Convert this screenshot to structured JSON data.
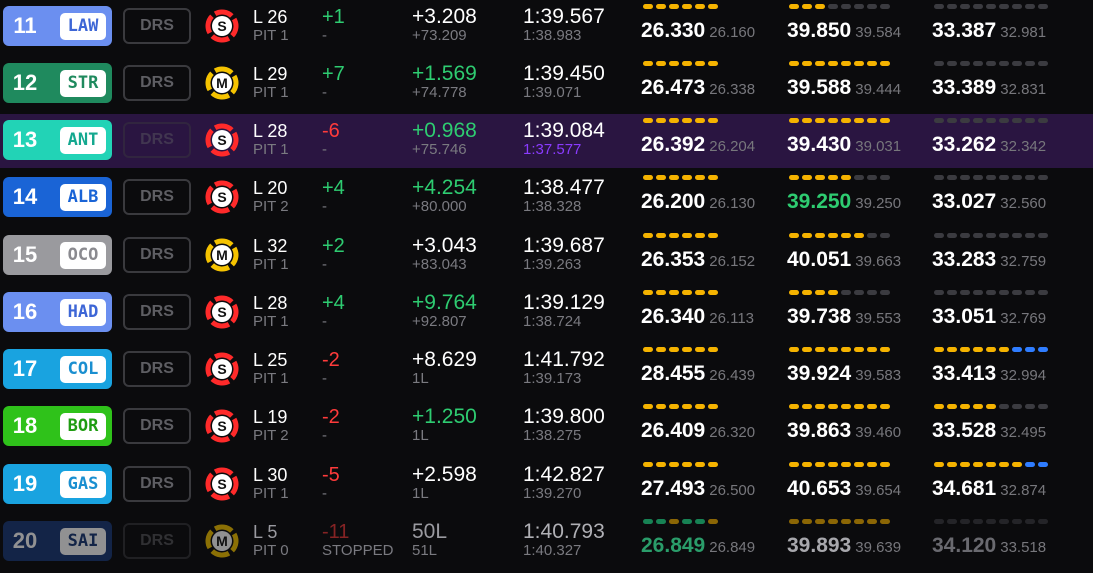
{
  "colors": {
    "yellow": "#f5b300",
    "grey": "#3b3b40",
    "blue": "#2f7dff",
    "green": "#1aa066",
    "soft": "#ff2a2a",
    "medium": "#f5c300",
    "purple": "#8a3bff"
  },
  "drs_label": "DRS",
  "rows": [
    {
      "pos": "11",
      "code": "LAW",
      "team_color": "#6b8ff0",
      "code_color": "#3d66d6",
      "tyre": "S",
      "lap": "L 26",
      "pit": "PIT 1",
      "chg": "+1",
      "chg_sub": "-",
      "gap": "+3.208",
      "gap_sub": "+73.209",
      "last": "1:39.567",
      "best": "1:38.983",
      "s1": "26.330",
      "s1b": "26.160",
      "s2": "39.850",
      "s2b": "39.584",
      "s3": "33.387",
      "s3b": "32.981",
      "m1": [
        "y",
        "y",
        "y",
        "y",
        "y",
        "y"
      ],
      "m2": [
        "y",
        "y",
        "y",
        "g",
        "g",
        "g",
        "g",
        "g"
      ],
      "m3": [
        "g",
        "g",
        "g",
        "g",
        "g",
        "g",
        "g",
        "g",
        "g"
      ]
    },
    {
      "pos": "12",
      "code": "STR",
      "team_color": "#1f8a5e",
      "code_color": "#1f8a5e",
      "tyre": "M",
      "lap": "L 29",
      "pit": "PIT 1",
      "chg": "+7",
      "chg_sub": "-",
      "gap": "+1.569",
      "gap_sub": "+74.778",
      "last": "1:39.450",
      "best": "1:39.071",
      "s1": "26.473",
      "s1b": "26.338",
      "s2": "39.588",
      "s2b": "39.444",
      "s3": "33.389",
      "s3b": "32.831",
      "m1": [
        "y",
        "y",
        "y",
        "y",
        "y",
        "y"
      ],
      "m2": [
        "y",
        "y",
        "y",
        "y",
        "y",
        "y",
        "y",
        "y"
      ],
      "m3": [
        "g",
        "g",
        "g",
        "g",
        "g",
        "g",
        "g",
        "g",
        "g"
      ]
    },
    {
      "pos": "13",
      "code": "ANT",
      "team_color": "#22d3b6",
      "code_color": "#14a88f",
      "tyre": "S",
      "lap": "L 28",
      "pit": "PIT 1",
      "chg": "-6",
      "chg_sub": "-",
      "gap": "+0.968",
      "gap_sub": "+75.746",
      "last": "1:39.084",
      "best": "1:37.577",
      "s1": "26.392",
      "s1b": "26.204",
      "s2": "39.430",
      "s2b": "39.031",
      "s3": "33.262",
      "s3b": "32.342",
      "m1": [
        "y",
        "y",
        "y",
        "y",
        "y",
        "y"
      ],
      "m2": [
        "y",
        "y",
        "y",
        "y",
        "y",
        "y",
        "y",
        "y"
      ],
      "m3": [
        "g",
        "g",
        "g",
        "g",
        "g",
        "g",
        "g",
        "g",
        "g"
      ]
    },
    {
      "pos": "14",
      "code": "ALB",
      "team_color": "#1a64d6",
      "code_color": "#1a64d6",
      "tyre": "S",
      "lap": "L 20",
      "pit": "PIT 2",
      "chg": "+4",
      "chg_sub": "-",
      "gap": "+4.254",
      "gap_sub": "+80.000",
      "last": "1:38.477",
      "best": "1:38.328",
      "s1": "26.200",
      "s1b": "26.130",
      "s2": "39.250",
      "s2b": "39.250",
      "s3": "33.027",
      "s3b": "32.560",
      "m1": [
        "y",
        "y",
        "y",
        "y",
        "y",
        "y"
      ],
      "m2": [
        "y",
        "y",
        "y",
        "y",
        "y",
        "g",
        "g",
        "g"
      ],
      "m3": [
        "g",
        "g",
        "g",
        "g",
        "g",
        "g",
        "g",
        "g",
        "g"
      ]
    },
    {
      "pos": "15",
      "code": "OCO",
      "team_color": "#9a9a9e",
      "code_color": "#8a8a8f",
      "tyre": "M",
      "lap": "L 32",
      "pit": "PIT 1",
      "chg": "+2",
      "chg_sub": "-",
      "gap": "+3.043",
      "gap_sub": "+83.043",
      "last": "1:39.687",
      "best": "1:39.263",
      "s1": "26.353",
      "s1b": "26.152",
      "s2": "40.051",
      "s2b": "39.663",
      "s3": "33.283",
      "s3b": "32.759",
      "m1": [
        "y",
        "y",
        "y",
        "y",
        "y",
        "y"
      ],
      "m2": [
        "y",
        "y",
        "y",
        "y",
        "y",
        "y",
        "g",
        "g"
      ],
      "m3": [
        "g",
        "g",
        "g",
        "g",
        "g",
        "g",
        "g",
        "g",
        "g"
      ]
    },
    {
      "pos": "16",
      "code": "HAD",
      "team_color": "#6b8ff0",
      "code_color": "#3d66d6",
      "tyre": "S",
      "lap": "L 28",
      "pit": "PIT 1",
      "chg": "+4",
      "chg_sub": "-",
      "gap": "+9.764",
      "gap_sub": "+92.807",
      "last": "1:39.129",
      "best": "1:38.724",
      "s1": "26.340",
      "s1b": "26.113",
      "s2": "39.738",
      "s2b": "39.553",
      "s3": "33.051",
      "s3b": "32.769",
      "m1": [
        "y",
        "y",
        "y",
        "y",
        "y",
        "y"
      ],
      "m2": [
        "y",
        "y",
        "y",
        "y",
        "g",
        "g",
        "g",
        "g"
      ],
      "m3": [
        "g",
        "g",
        "g",
        "g",
        "g",
        "g",
        "g",
        "g",
        "g"
      ]
    },
    {
      "pos": "17",
      "code": "COL",
      "team_color": "#19a3e0",
      "code_color": "#1a8fd0",
      "tyre": "S",
      "lap": "L 25",
      "pit": "PIT 1",
      "chg": "-2",
      "chg_sub": "-",
      "gap": "+8.629",
      "gap_sub": "1L",
      "last": "1:41.792",
      "best": "1:39.173",
      "s1": "28.455",
      "s1b": "26.439",
      "s2": "39.924",
      "s2b": "39.583",
      "s3": "33.413",
      "s3b": "32.994",
      "m1": [
        "y",
        "y",
        "y",
        "y",
        "y",
        "y"
      ],
      "m2": [
        "y",
        "y",
        "y",
        "y",
        "y",
        "y",
        "y",
        "y"
      ],
      "m3": [
        "y",
        "y",
        "y",
        "y",
        "y",
        "y",
        "b",
        "b",
        "b"
      ]
    },
    {
      "pos": "18",
      "code": "BOR",
      "team_color": "#2fc21a",
      "code_color": "#1f9c12",
      "tyre": "S",
      "lap": "L 19",
      "pit": "PIT 2",
      "chg": "-2",
      "chg_sub": "-",
      "gap": "+1.250",
      "gap_sub": "1L",
      "last": "1:39.800",
      "best": "1:38.275",
      "s1": "26.409",
      "s1b": "26.320",
      "s2": "39.863",
      "s2b": "39.460",
      "s3": "33.528",
      "s3b": "32.495",
      "m1": [
        "y",
        "y",
        "y",
        "y",
        "y",
        "y"
      ],
      "m2": [
        "y",
        "y",
        "y",
        "y",
        "y",
        "y",
        "y",
        "y"
      ],
      "m3": [
        "y",
        "y",
        "y",
        "y",
        "y",
        "g",
        "g",
        "g",
        "g"
      ]
    },
    {
      "pos": "19",
      "code": "GAS",
      "team_color": "#19a3e0",
      "code_color": "#1a8fd0",
      "tyre": "S",
      "lap": "L 30",
      "pit": "PIT 1",
      "chg": "-5",
      "chg_sub": "-",
      "gap": "+2.598",
      "gap_sub": "1L",
      "last": "1:42.827",
      "best": "1:39.270",
      "s1": "27.493",
      "s1b": "26.500",
      "s2": "40.653",
      "s2b": "39.654",
      "s3": "34.681",
      "s3b": "32.874",
      "m1": [
        "y",
        "y",
        "y",
        "y",
        "y",
        "y"
      ],
      "m2": [
        "y",
        "y",
        "y",
        "y",
        "y",
        "y",
        "y",
        "y"
      ],
      "m3": [
        "y",
        "y",
        "y",
        "y",
        "y",
        "y",
        "y",
        "b",
        "b"
      ]
    },
    {
      "pos": "20",
      "code": "SAI",
      "team_color": "#1a3a78",
      "code_color": "#1a3a78",
      "tyre": "M",
      "lap": "L 5",
      "pit": "PIT 0",
      "chg": "-11",
      "chg_sub": "STOPPED",
      "gap": "50L",
      "gap_sub": "51L",
      "last": "1:40.793",
      "best": "1:40.327",
      "s1": "26.849",
      "s1b": "26.849",
      "s2": "39.893",
      "s2b": "39.639",
      "s3": "34.120",
      "s3b": "33.518",
      "m1": [
        "gr",
        "gr",
        "y",
        "gr",
        "gr",
        "y"
      ],
      "m2": [
        "y",
        "y",
        "y",
        "y",
        "y",
        "y",
        "y",
        "y"
      ],
      "m3": [
        "g",
        "g",
        "g",
        "g",
        "g",
        "g",
        "g",
        "g",
        "g"
      ]
    }
  ]
}
